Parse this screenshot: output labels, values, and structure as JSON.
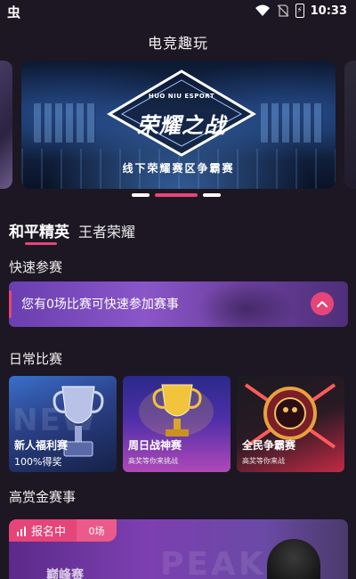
{
  "status_bar": {
    "app_icon": "虫",
    "time": "10:33",
    "battery_glyph": "⚡",
    "icons": [
      "wifi-icon",
      "no-sim-icon",
      "battery-charging-icon"
    ]
  },
  "header": {
    "title": "电竞趣玩"
  },
  "banner": {
    "brand": "HUO NIU ESPORT",
    "headline": "荣耀之战",
    "subtitle": "线下荣耀赛区争霸赛",
    "active_index": 1,
    "slide_count": 3
  },
  "game_tabs": [
    {
      "label": "和平精英",
      "active": true
    },
    {
      "label": "王者荣耀",
      "active": false
    }
  ],
  "quick_join": {
    "section_title": "快速参赛",
    "text": "您有0场比赛可快速参加赛事",
    "button_icon": "chevron-up-icon"
  },
  "daily": {
    "section_title": "日常比赛",
    "cards": [
      {
        "name": "新人福利赛",
        "desc": "100%得奖",
        "bg_text": "NEW"
      },
      {
        "name": "周日战神赛",
        "desc": "高奖等你来挑战",
        "bg_text": ""
      },
      {
        "name": "全民争霸赛",
        "desc": "高奖等你来战",
        "bg_text": ""
      }
    ]
  },
  "reward": {
    "section_title": "高赏金赛事",
    "status": "报名中",
    "count": "0场",
    "title": "巅峰赛",
    "watermark": "PEAK"
  },
  "colors": {
    "background": "#1c1722",
    "accent": "#e6457a",
    "purple": "#7d3fb0"
  }
}
